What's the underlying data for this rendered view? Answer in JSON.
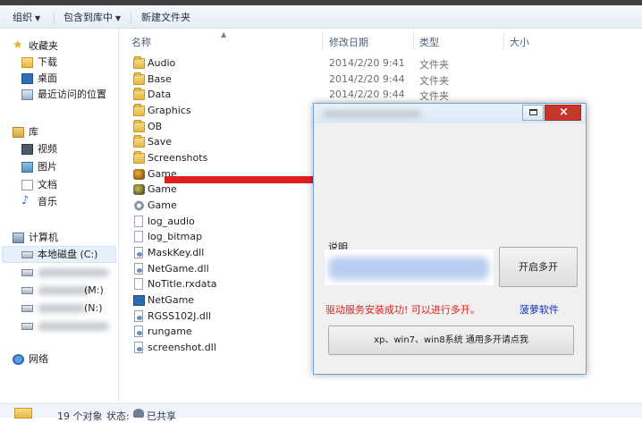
{
  "toolbar": {
    "organize": "组织",
    "include_library": "包含到库中",
    "new_folder": "新建文件夹"
  },
  "nav": {
    "favorites": "收藏夹",
    "downloads": "下载",
    "desktop": "桌面",
    "recent": "最近访问的位置",
    "libraries": "库",
    "videos": "视频",
    "pictures": "图片",
    "documents": "文档",
    "music": "音乐",
    "computer": "计算机",
    "local_disk": "本地磁盘 (C:)",
    "drive_m": "(M:)",
    "drive_n": "(N:)",
    "network": "网络"
  },
  "columns": {
    "name": "名称",
    "modified": "修改日期",
    "type": "类型",
    "size": "大小"
  },
  "files": [
    {
      "name": "Audio",
      "date": "2014/2/20 9:41",
      "type": "文件夹",
      "icon": "folder-icon"
    },
    {
      "name": "Base",
      "date": "2014/2/20 9:44",
      "type": "文件夹",
      "icon": "folder-icon"
    },
    {
      "name": "Data",
      "date": "2014/2/20 9:44",
      "type": "文件夹",
      "icon": "folder-icon"
    },
    {
      "name": "Graphics",
      "date": "",
      "type": "",
      "icon": "folder-icon"
    },
    {
      "name": "OB",
      "date": "",
      "type": "",
      "icon": "folder-icon"
    },
    {
      "name": "Save",
      "date": "",
      "type": "",
      "icon": "folder-icon"
    },
    {
      "name": "Screenshots",
      "date": "",
      "type": "",
      "icon": "folder-icon"
    },
    {
      "name": "Game",
      "date": "",
      "type": "",
      "icon": "game-exe-icon"
    },
    {
      "name": "Game",
      "date": "",
      "type": "",
      "icon": "game-exe-icon"
    },
    {
      "name": "Game",
      "date": "",
      "type": "",
      "icon": "settings-file-icon"
    },
    {
      "name": "log_audio",
      "date": "",
      "type": "",
      "icon": "text-file-icon"
    },
    {
      "name": "log_bitmap",
      "date": "",
      "type": "",
      "icon": "text-file-icon"
    },
    {
      "name": "MaskKey.dll",
      "date": "",
      "type": "",
      "icon": "dll-file-icon"
    },
    {
      "name": "NetGame.dll",
      "date": "",
      "type": "",
      "icon": "dll-file-icon"
    },
    {
      "name": "NoTitle.rxdata",
      "date": "",
      "type": "",
      "icon": "text-file-icon"
    },
    {
      "name": "NetGame",
      "date": "",
      "type": "",
      "icon": "app-icon"
    },
    {
      "name": "RGSS102J.dll",
      "date": "",
      "type": "",
      "icon": "dll-file-icon"
    },
    {
      "name": "rungame",
      "date": "",
      "type": "",
      "icon": "dll-file-icon"
    },
    {
      "name": "screenshot.dll",
      "date": "",
      "type": "",
      "icon": "dll-file-icon"
    }
  ],
  "status": {
    "count": "19 个对象",
    "state_label": "状态:",
    "state_value": "已共享"
  },
  "dialog": {
    "group_label": "说明",
    "multi_button": "开启多开",
    "success_message": "驱动服务安装成功! 可以进行多开。",
    "link": "菠萝软件",
    "wide_button": "xp、win7、win8系统 通用多开请点我"
  },
  "colors": {
    "arrow": "#e0201f",
    "message": "#e0201f",
    "link": "#1230b8",
    "close_button": "#c7362a"
  }
}
